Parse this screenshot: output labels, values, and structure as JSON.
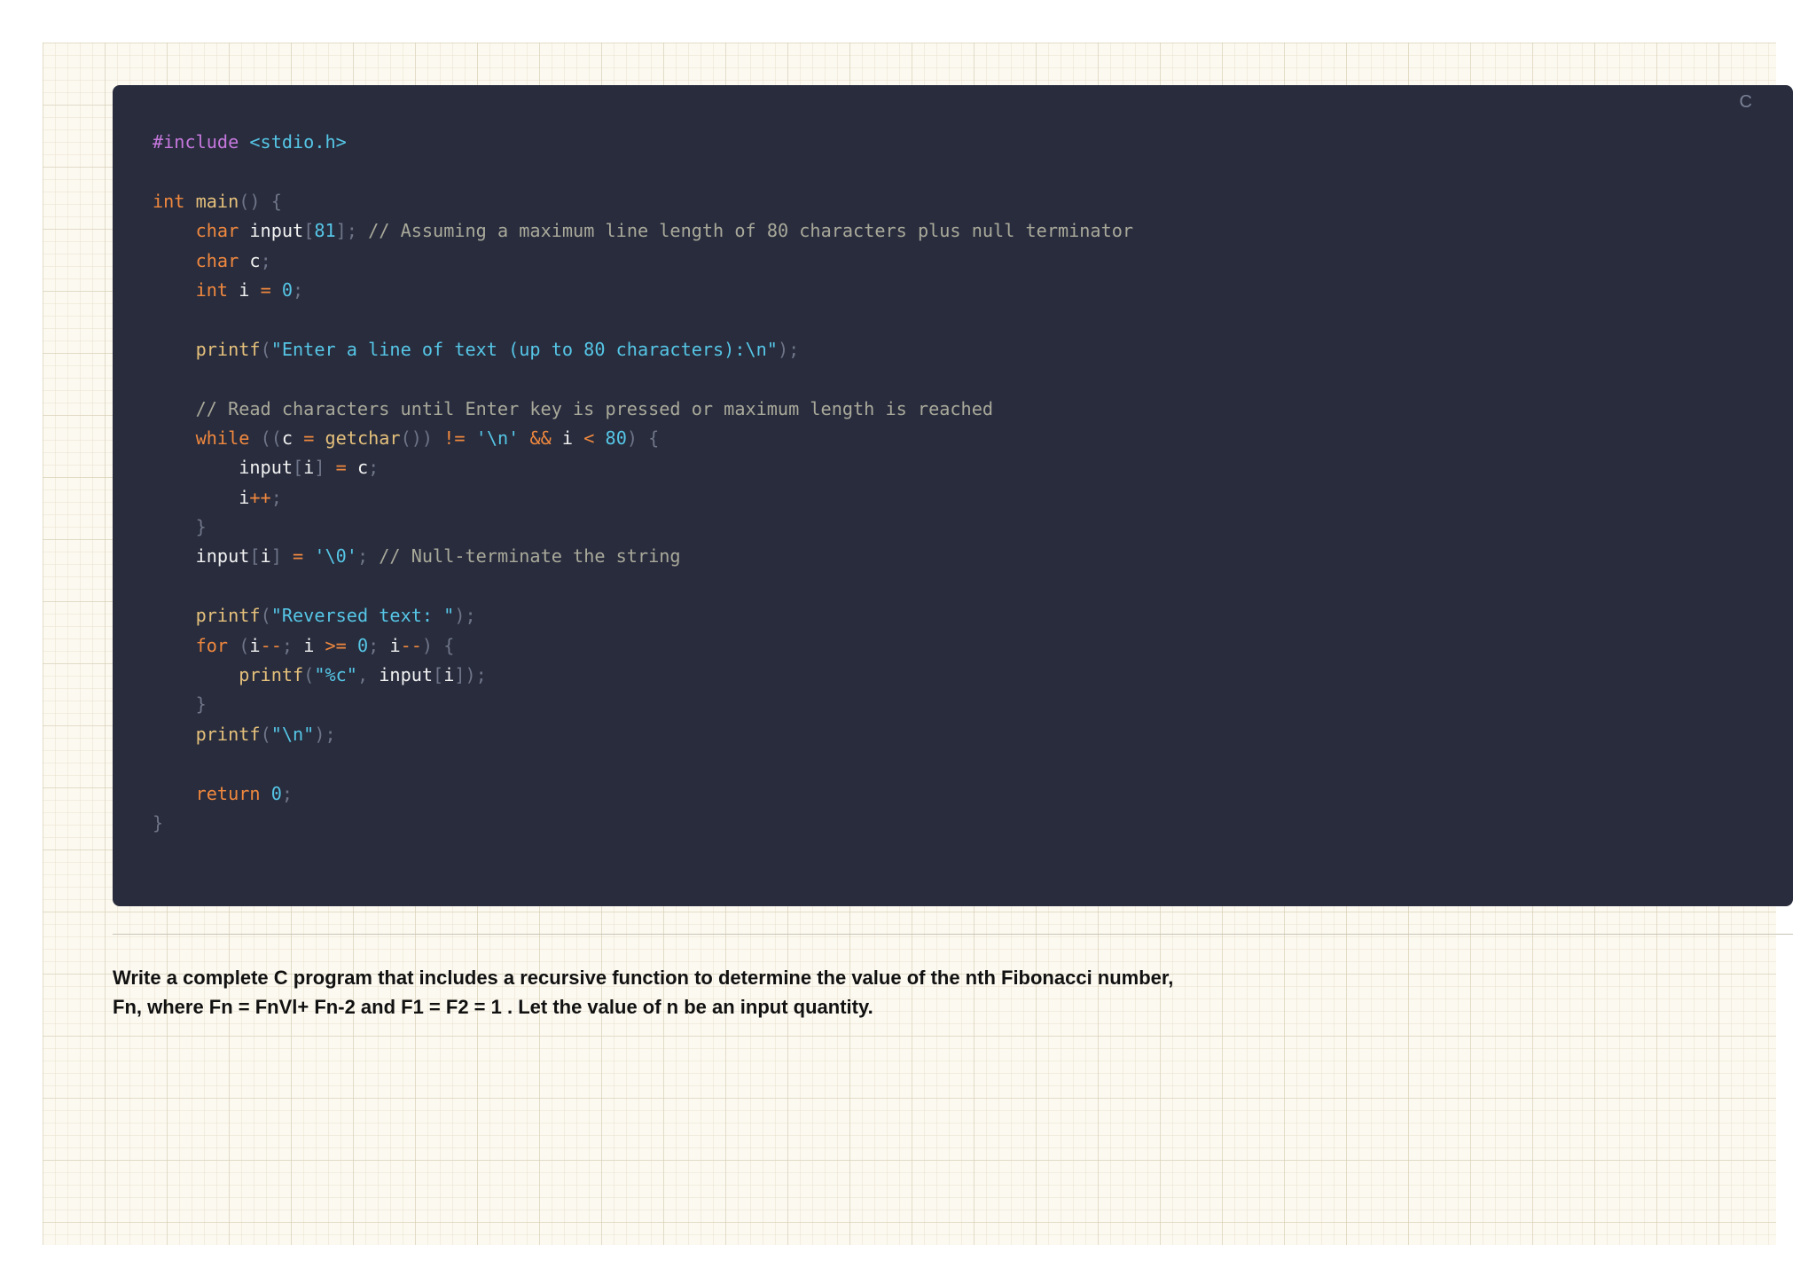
{
  "code_block": {
    "language": "C",
    "lines": [
      [
        {
          "t": "pre",
          "s": "#include "
        },
        {
          "t": "str",
          "s": "<stdio.h>"
        }
      ],
      [],
      [
        {
          "t": "kw",
          "s": "int "
        },
        {
          "t": "fn",
          "s": "main"
        },
        {
          "t": "pn",
          "s": "() {"
        }
      ],
      [
        {
          "t": "id",
          "s": "    "
        },
        {
          "t": "kw",
          "s": "char "
        },
        {
          "t": "id",
          "s": "input"
        },
        {
          "t": "pn",
          "s": "["
        },
        {
          "t": "num",
          "s": "81"
        },
        {
          "t": "pn",
          "s": "]; "
        },
        {
          "t": "cm",
          "s": "// Assuming a maximum line length of 80 characters plus null terminator"
        }
      ],
      [
        {
          "t": "id",
          "s": "    "
        },
        {
          "t": "kw",
          "s": "char "
        },
        {
          "t": "id",
          "s": "c"
        },
        {
          "t": "pn",
          "s": ";"
        }
      ],
      [
        {
          "t": "id",
          "s": "    "
        },
        {
          "t": "kw",
          "s": "int "
        },
        {
          "t": "id",
          "s": "i "
        },
        {
          "t": "op",
          "s": "= "
        },
        {
          "t": "num",
          "s": "0"
        },
        {
          "t": "pn",
          "s": ";"
        }
      ],
      [],
      [
        {
          "t": "id",
          "s": "    "
        },
        {
          "t": "fn",
          "s": "printf"
        },
        {
          "t": "pn",
          "s": "("
        },
        {
          "t": "str",
          "s": "\"Enter a line of text (up to 80 characters):\\n\""
        },
        {
          "t": "pn",
          "s": ");"
        }
      ],
      [],
      [
        {
          "t": "id",
          "s": "    "
        },
        {
          "t": "cm",
          "s": "// Read characters until Enter key is pressed or maximum length is reached"
        }
      ],
      [
        {
          "t": "id",
          "s": "    "
        },
        {
          "t": "kw",
          "s": "while "
        },
        {
          "t": "pn",
          "s": "(("
        },
        {
          "t": "id",
          "s": "c "
        },
        {
          "t": "op",
          "s": "= "
        },
        {
          "t": "fn",
          "s": "getchar"
        },
        {
          "t": "pn",
          "s": "()) "
        },
        {
          "t": "op",
          "s": "!= "
        },
        {
          "t": "str",
          "s": "'\\n' "
        },
        {
          "t": "op",
          "s": "&& "
        },
        {
          "t": "id",
          "s": "i "
        },
        {
          "t": "op",
          "s": "< "
        },
        {
          "t": "num",
          "s": "80"
        },
        {
          "t": "pn",
          "s": ") {"
        }
      ],
      [
        {
          "t": "id",
          "s": "        input"
        },
        {
          "t": "pn",
          "s": "["
        },
        {
          "t": "id",
          "s": "i"
        },
        {
          "t": "pn",
          "s": "] "
        },
        {
          "t": "op",
          "s": "= "
        },
        {
          "t": "id",
          "s": "c"
        },
        {
          "t": "pn",
          "s": ";"
        }
      ],
      [
        {
          "t": "id",
          "s": "        i"
        },
        {
          "t": "op",
          "s": "++"
        },
        {
          "t": "pn",
          "s": ";"
        }
      ],
      [
        {
          "t": "pn",
          "s": "    }"
        }
      ],
      [
        {
          "t": "id",
          "s": "    input"
        },
        {
          "t": "pn",
          "s": "["
        },
        {
          "t": "id",
          "s": "i"
        },
        {
          "t": "pn",
          "s": "] "
        },
        {
          "t": "op",
          "s": "= "
        },
        {
          "t": "str",
          "s": "'\\0'"
        },
        {
          "t": "pn",
          "s": "; "
        },
        {
          "t": "cm",
          "s": "// Null-terminate the string"
        }
      ],
      [],
      [
        {
          "t": "id",
          "s": "    "
        },
        {
          "t": "fn",
          "s": "printf"
        },
        {
          "t": "pn",
          "s": "("
        },
        {
          "t": "str",
          "s": "\"Reversed text: \""
        },
        {
          "t": "pn",
          "s": ");"
        }
      ],
      [
        {
          "t": "id",
          "s": "    "
        },
        {
          "t": "kw",
          "s": "for "
        },
        {
          "t": "pn",
          "s": "("
        },
        {
          "t": "id",
          "s": "i"
        },
        {
          "t": "op",
          "s": "--"
        },
        {
          "t": "pn",
          "s": "; "
        },
        {
          "t": "id",
          "s": "i "
        },
        {
          "t": "op",
          "s": ">= "
        },
        {
          "t": "num",
          "s": "0"
        },
        {
          "t": "pn",
          "s": "; "
        },
        {
          "t": "id",
          "s": "i"
        },
        {
          "t": "op",
          "s": "--"
        },
        {
          "t": "pn",
          "s": ") {"
        }
      ],
      [
        {
          "t": "id",
          "s": "        "
        },
        {
          "t": "fn",
          "s": "printf"
        },
        {
          "t": "pn",
          "s": "("
        },
        {
          "t": "str",
          "s": "\"%c\""
        },
        {
          "t": "pn",
          "s": ", "
        },
        {
          "t": "id",
          "s": "input"
        },
        {
          "t": "pn",
          "s": "["
        },
        {
          "t": "id",
          "s": "i"
        },
        {
          "t": "pn",
          "s": "]);"
        }
      ],
      [
        {
          "t": "pn",
          "s": "    }"
        }
      ],
      [
        {
          "t": "id",
          "s": "    "
        },
        {
          "t": "fn",
          "s": "printf"
        },
        {
          "t": "pn",
          "s": "("
        },
        {
          "t": "str",
          "s": "\"\\n\""
        },
        {
          "t": "pn",
          "s": ");"
        }
      ],
      [],
      [
        {
          "t": "id",
          "s": "    "
        },
        {
          "t": "kw",
          "s": "return "
        },
        {
          "t": "num",
          "s": "0"
        },
        {
          "t": "pn",
          "s": ";"
        }
      ],
      [
        {
          "t": "pn",
          "s": "}"
        }
      ]
    ]
  },
  "question": {
    "text": "Write a complete C program that includes a recursive function to determine the value of the nth Fibonacci number, Fn, where Fn = FnVl+ Fn-2 and F1 = F2 = 1 . Let the value of n be an input quantity."
  },
  "colors": {
    "code_background": "#282c3d",
    "paper_background": "#fcf9f1",
    "keyword": "#f0883e",
    "function": "#e5c07b",
    "string": "#56c6e6",
    "comment": "#a9a99a",
    "preprocessor": "#c678dd"
  }
}
